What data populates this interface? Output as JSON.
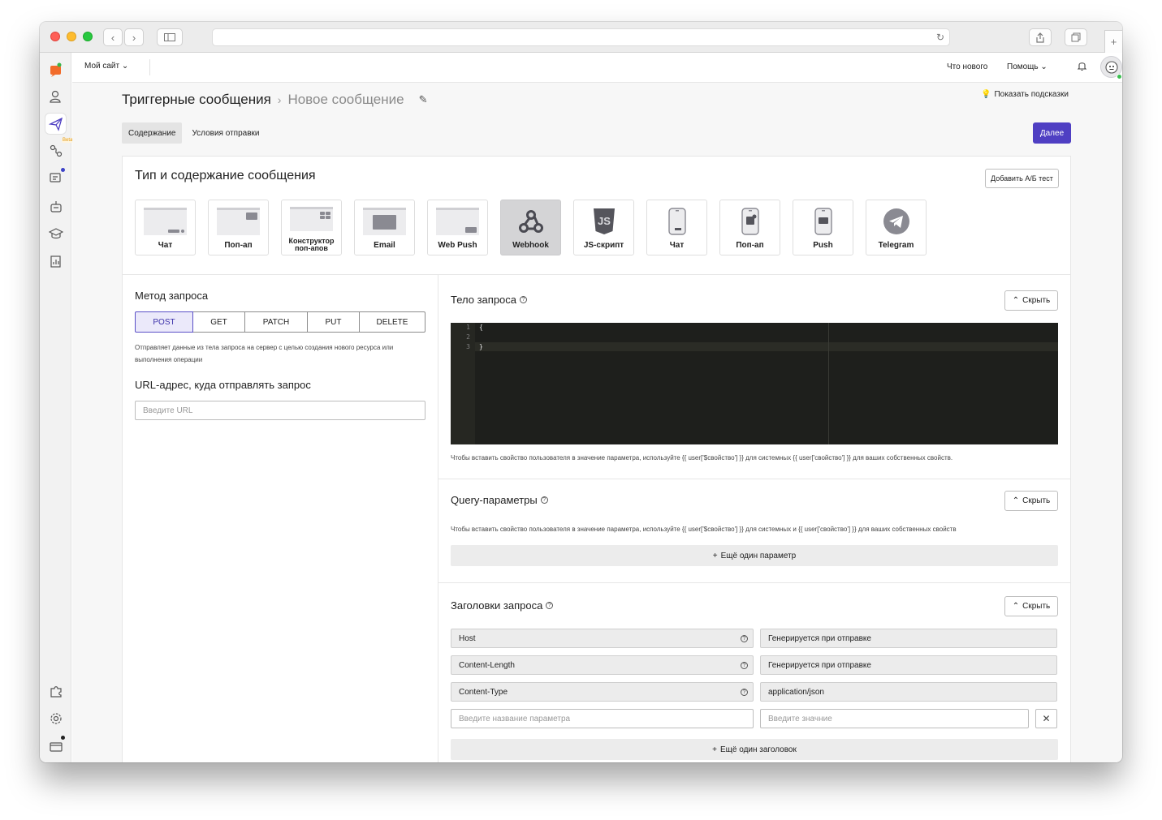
{
  "browser": {
    "back_icon": "chevron-left-icon",
    "forward_icon": "chevron-right-icon",
    "sidebar_icon": "sidebar-icon",
    "share_icon": "share-icon",
    "tabs_icon": "tabs-icon",
    "new_tab_icon": "plus-icon",
    "address_value": ""
  },
  "topbar": {
    "site_label": "Мой сайт",
    "whats_new": "Что нового",
    "help": "Помощь"
  },
  "rail": {
    "beta_label": "Beta"
  },
  "page": {
    "breadcrumb_root": "Триггерные сообщения",
    "breadcrumb_current": "Новое сообщение",
    "hints_label": "Показать подсказки",
    "tabs": [
      "Содержание",
      "Условия отправки"
    ],
    "active_tab": 0,
    "next_button": "Далее"
  },
  "type_section": {
    "title": "Тип и содержание сообщения",
    "ab_button": "Добавить А/Б тест",
    "types": [
      {
        "label": "Чат",
        "icon": "web-chat-icon"
      },
      {
        "label": "Поп-ап",
        "icon": "web-popup-icon"
      },
      {
        "label": "Конструктор поп-апов",
        "icon": "popup-builder-icon"
      },
      {
        "label": "Email",
        "icon": "email-icon"
      },
      {
        "label": "Web Push",
        "icon": "web-push-icon"
      },
      {
        "label": "Webhook",
        "icon": "webhook-icon"
      },
      {
        "label": "JS-скрипт",
        "icon": "js-icon"
      },
      {
        "label": "Чат",
        "icon": "mobile-chat-icon"
      },
      {
        "label": "Поп-ап",
        "icon": "mobile-popup-icon"
      },
      {
        "label": "Push",
        "icon": "mobile-push-icon"
      },
      {
        "label": "Telegram",
        "icon": "telegram-icon"
      }
    ],
    "active_type": 5
  },
  "method_section": {
    "title": "Метод запроса",
    "methods": [
      "POST",
      "GET",
      "PATCH",
      "PUT",
      "DELETE"
    ],
    "active_method": 0,
    "description": "Отправляет данные из тела запроса на сервер с целью создания нового ресурса или выполнения операции",
    "url_title": "URL-адрес, куда отправлять запрос",
    "url_placeholder": "Введите URL"
  },
  "body_section": {
    "title": "Тело запроса",
    "hide_button": "Скрыть",
    "lines": [
      {
        "num": "1",
        "code": "{"
      },
      {
        "num": "2",
        "code": ""
      },
      {
        "num": "3",
        "code": "}"
      }
    ],
    "hint": "Чтобы вставить свойство пользователя в значение параметра, используйте {{ user['$свойство'] }} для системных {{ user['свойство'] }} для ваших собственных свойств."
  },
  "query_section": {
    "title": "Query-параметры",
    "hide_button": "Скрыть",
    "hint": "Чтобы вставить свойство пользователя в значение параметра, используйте {{ user['$свойство'] }} для системных и {{ user['свойство'] }} для ваших собственных свойств",
    "add_button": "Ещё один параметр"
  },
  "headers_section": {
    "title": "Заголовки запроса",
    "hide_button": "Скрыть",
    "rows": [
      {
        "key": "Host",
        "value": "Генерируется при отправке"
      },
      {
        "key": "Content-Length",
        "value": "Генерируется при отправке"
      },
      {
        "key": "Content-Type",
        "value": "application/json"
      }
    ],
    "new_key_placeholder": "Введите название параметра",
    "new_value_placeholder": "Введите значние",
    "add_button": "Ещё один заголовок"
  }
}
